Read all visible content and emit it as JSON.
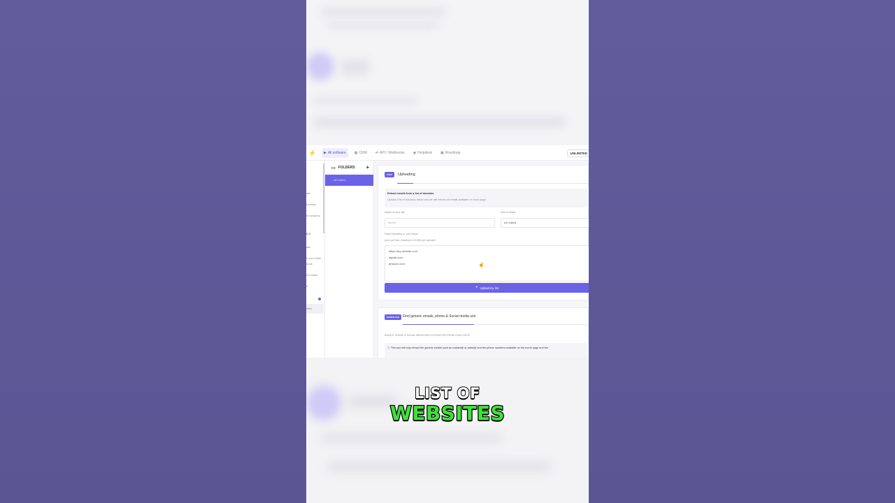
{
  "nav": {
    "items": [
      {
        "label": "All software",
        "icon": "play-icon",
        "active": true
      },
      {
        "label": "CRM",
        "icon": "crm-icon",
        "active": false
      },
      {
        "label": "API / Webhooks",
        "icon": "api-icon",
        "active": false
      },
      {
        "label": "Helpdesk",
        "icon": "help-icon",
        "active": false
      },
      {
        "label": "Roadmap",
        "icon": "calendar-icon",
        "active": false
      }
    ],
    "plan_label": "UNLIMITED"
  },
  "leftnav": {
    "items": [
      "ails",
      "Domain",
      "a company",
      "ILS",
      "ails",
      "n your visits",
      "ouds",
      "ct emails",
      "n",
      "lities"
    ]
  },
  "folders": {
    "header": "FOLDERS",
    "add": "+",
    "all_label": "All folders"
  },
  "upload_card": {
    "badge": "STEP",
    "title": "Uploading",
    "info_title": "Extract emails from a list of domains.",
    "info_text": "Upload a list of domains below and we will extract all emails available on each page.",
    "name_label": "Name of your list",
    "name_placeholder": "My list",
    "folder_label": "Add to folder",
    "folder_value": "(no folder)",
    "paste_label": "Paste domains or urls below",
    "paste_hint": "(one per line, maximum 10,000 per upload)",
    "domains": [
      "https://my-website.com",
      "algolia.com",
      "amazon.com"
    ],
    "upload_button": "Upload my list"
  },
  "generic_card": {
    "badge": "DOWNLOAD",
    "title": "Find generic emails, phone & Social media urls",
    "subtitle": "EMAILS, PHONE & SOCIAL MEDIA URLS EXTRACTED FROM YOUR LISTS",
    "info": "This tool will only extract the generic emails such as contact@ or sales@ and the phone numbers available on the home page and the"
  },
  "caption": {
    "line1": "LIST OF",
    "line2": "WEBSITES"
  },
  "colors": {
    "accent": "#6b63e6",
    "caption_green": "#3ee33a",
    "background": "#5e5898"
  }
}
